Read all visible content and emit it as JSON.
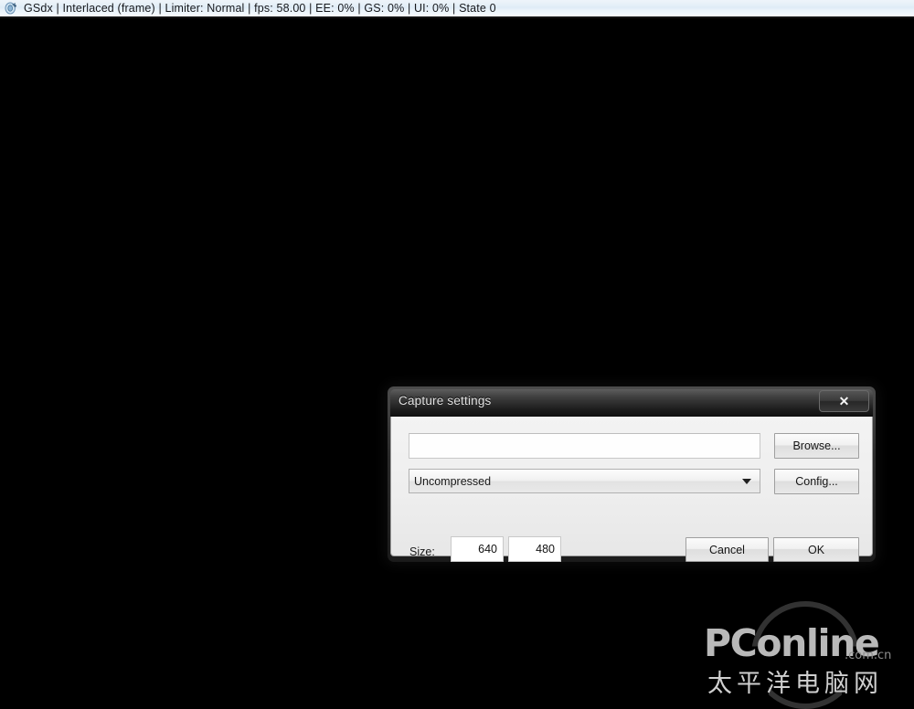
{
  "app_titlebar": {
    "icon": "pcsx2-app-icon",
    "status_text": "GSdx | Interlaced (frame) | Limiter: Normal | fps:  58.00 | EE:  0% | GS:  0% | UI:  0% | State 0",
    "plugin": "GSdx",
    "interlaced": "Interlaced (frame)",
    "limiter": "Limiter: Normal",
    "fps": "58.00",
    "ee_percent": "0%",
    "gs_percent": "0%",
    "ui_percent": "0%",
    "state": "State 0"
  },
  "viewport": {
    "background_color": "#000000"
  },
  "dialog": {
    "title": "Capture settings",
    "close_glyph": "✕",
    "path": {
      "value": "",
      "placeholder": ""
    },
    "browse_label": "Browse...",
    "codec": {
      "selected": "Uncompressed",
      "options": [
        "Uncompressed"
      ]
    },
    "config_label": "Config...",
    "size_label": "Size:",
    "size_width": "640",
    "size_height": "480",
    "cancel_label": "Cancel",
    "ok_label": "OK"
  },
  "watermark": {
    "brand": "PConline",
    "suffix": ".com.cn",
    "chinese": "太平洋电脑网"
  },
  "colors": {
    "titlebar_gradient_top": "#eef4fa",
    "titlebar_gradient_bottom": "#f6fbff",
    "dialog_frame": "#2b2b2b",
    "dialog_body": "#eeeeee",
    "viewport": "#000000"
  }
}
